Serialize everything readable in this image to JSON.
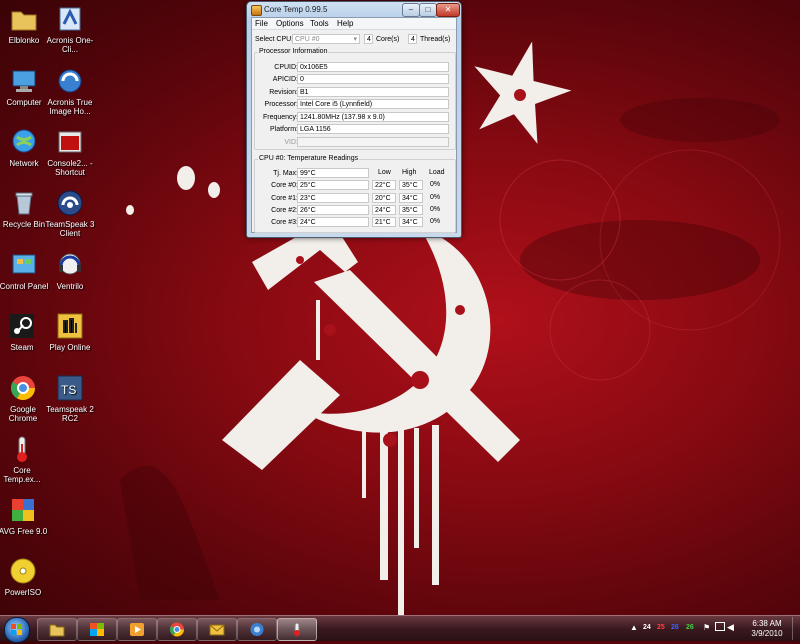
{
  "desktop_icons": [
    {
      "label": "Elblonko"
    },
    {
      "label": "Acronis One-Cli..."
    },
    {
      "label": "Computer"
    },
    {
      "label": "Acronis True Image Ho..."
    },
    {
      "label": "Network"
    },
    {
      "label": "Console2... - Shortcut"
    },
    {
      "label": "Recycle Bin"
    },
    {
      "label": "TeamSpeak 3 Client"
    },
    {
      "label": "Control Panel"
    },
    {
      "label": "Ventrilo"
    },
    {
      "label": "Steam"
    },
    {
      "label": "Play Online"
    },
    {
      "label": "Google Chrome"
    },
    {
      "label": "Teamspeak 2 RC2"
    },
    {
      "label": "Core Temp.ex..."
    },
    {
      "label": "AVG Free 9.0"
    },
    {
      "label": "PowerISO"
    }
  ],
  "window": {
    "title": "Core Temp 0.99.5",
    "min_glyph": "–",
    "max_glyph": "□",
    "close_glyph": "✕",
    "menu": [
      "File",
      "Options",
      "Tools",
      "Help"
    ],
    "select_cpu_label": "Select CPU:",
    "select_cpu_value": "CPU #0",
    "cores_value": "4",
    "cores_label": "Core(s)",
    "threads_value": "4",
    "threads_label": "Thread(s)",
    "processor_info_title": "Processor Information",
    "info": [
      {
        "label": "CPUID:",
        "value": "0x106E5"
      },
      {
        "label": "APICID:",
        "value": "0"
      },
      {
        "label": "Revision:",
        "value": "B1"
      },
      {
        "label": "Processor:",
        "value": "Intel Core i5 (Lynnfield)"
      },
      {
        "label": "Frequency:",
        "value": "1241.80MHz (137.98 x 9.0)"
      },
      {
        "label": "Platform:",
        "value": "LGA 1156"
      },
      {
        "label": "VID:",
        "value": ""
      }
    ],
    "temps_title": "CPU #0: Temperature Readings",
    "headers": {
      "low": "Low",
      "high": "High",
      "load": "Load"
    },
    "tj_label": "Tj. Max:",
    "tj_value": "99°C",
    "cores": [
      {
        "label": "Core #0:",
        "temp": "25°C",
        "low": "22°C",
        "high": "35°C",
        "load": "0%"
      },
      {
        "label": "Core #1:",
        "temp": "23°C",
        "low": "20°C",
        "high": "34°C",
        "load": "0%"
      },
      {
        "label": "Core #2:",
        "temp": "26°C",
        "low": "24°C",
        "high": "35°C",
        "load": "0%"
      },
      {
        "label": "Core #3:",
        "temp": "24°C",
        "low": "21°C",
        "high": "34°C",
        "load": "0%"
      }
    ]
  },
  "tray": {
    "temps": [
      {
        "value": "24",
        "color": "#ffffff"
      },
      {
        "value": "25",
        "color": "#ff4040"
      },
      {
        "value": "26",
        "color": "#4060ff"
      },
      {
        "value": "26",
        "color": "#40d040"
      }
    ],
    "time": "6:38 AM",
    "date": "3/9/2010"
  }
}
